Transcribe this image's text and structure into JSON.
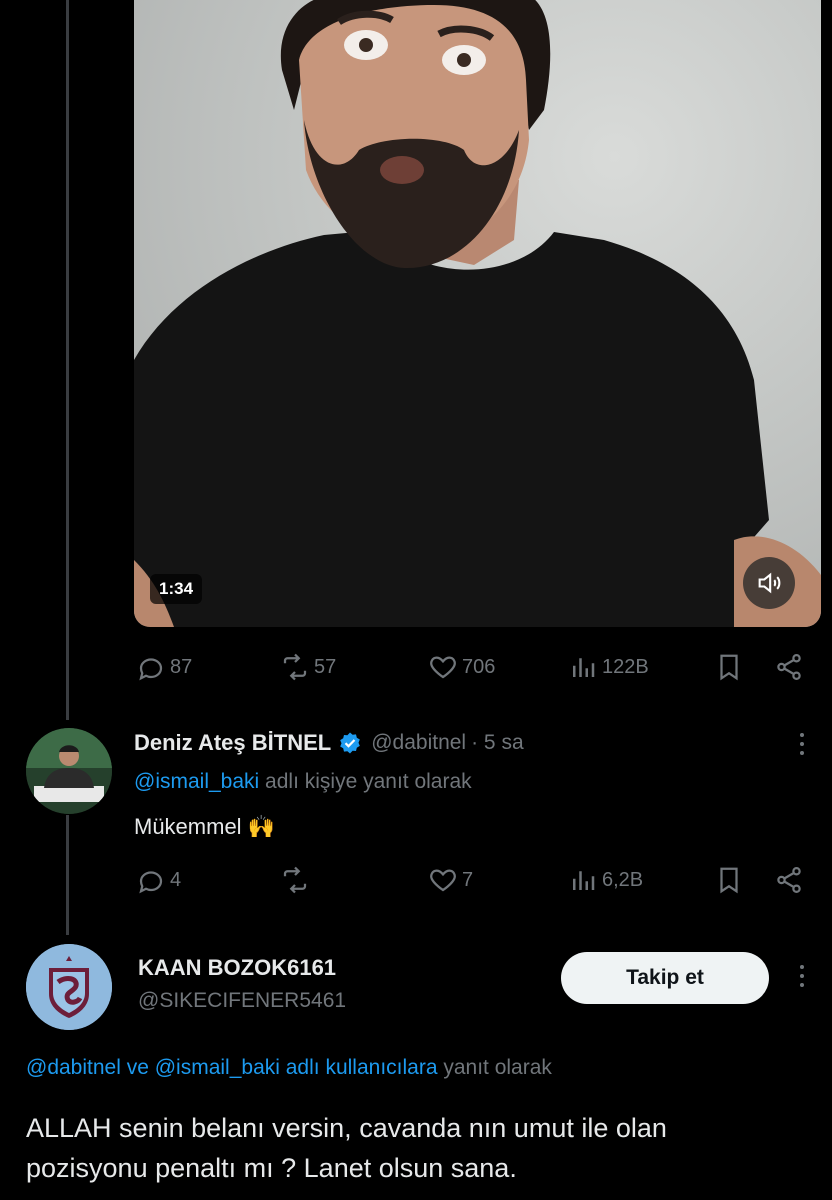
{
  "video": {
    "duration": "1:34"
  },
  "main_tweet_actions": {
    "replies": "87",
    "retweets": "57",
    "likes": "706",
    "views": "122B"
  },
  "reply1": {
    "name": "Deniz Ateş BİTNEL",
    "handle": "@dabitnel",
    "time": "· 5 sa",
    "reply_to_user": "@ismail_baki",
    "reply_to_suffix": "adlı kişiye yanıt olarak",
    "text": "Mükemmel",
    "emoji": "🙌",
    "replies": "4",
    "retweets": "",
    "likes": "7",
    "views": "6,2B"
  },
  "reply2": {
    "name": "KAAN BOZOK6161",
    "handle": "@SIKECIFENER5461",
    "follow_label": "Takip et",
    "reply_to_users": "@dabitnel ve @ismail_baki adlı kullanıcılara",
    "reply_to_suffix": "yanıt olarak",
    "text_line1": "ALLAH senin belanı versin, cavanda nın umut ile olan",
    "text_line2": "pozisyonu penaltı mı ? Lanet olsun sana."
  },
  "colors": {
    "accent": "#1d9bf0",
    "muted": "#71767b",
    "background": "#000000",
    "thread_line": "#3a3d41"
  }
}
